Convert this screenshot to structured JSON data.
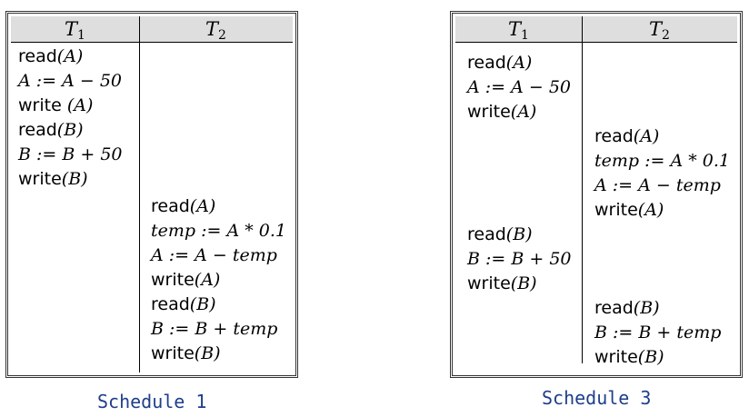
{
  "schedule1": {
    "caption": "Schedule 1",
    "col1": "T",
    "col1_sub": "1",
    "col2": "T",
    "col2_sub": "2",
    "t1": [
      {
        "fn": "read",
        "arg": "(A)"
      },
      {
        "expr": "A := A − 50"
      },
      {
        "fn": "write",
        "arg": " (A)"
      },
      {
        "fn": "read",
        "arg": "(B)"
      },
      {
        "expr": "B := B + 50"
      },
      {
        "fn": "write",
        "arg": "(B)"
      }
    ],
    "t2": [
      {
        "fn": "read",
        "arg": "(A)"
      },
      {
        "expr": "temp := A * 0.1"
      },
      {
        "expr": "A := A − temp"
      },
      {
        "fn": "write",
        "arg": "(A)"
      },
      {
        "fn": "read",
        "arg": "(B)"
      },
      {
        "expr": "B := B + temp"
      },
      {
        "fn": "write",
        "arg": "(B)"
      }
    ]
  },
  "schedule3": {
    "caption": "Schedule 3",
    "col1": "T",
    "col1_sub": "1",
    "col2": "T",
    "col2_sub": "2",
    "t1a": [
      {
        "fn": "read",
        "arg": "(A)"
      },
      {
        "expr": "A := A − 50"
      },
      {
        "fn": "write",
        "arg": "(A)"
      }
    ],
    "t2a": [
      {
        "fn": "read",
        "arg": "(A)"
      },
      {
        "expr": "temp := A * 0.1"
      },
      {
        "expr": "A := A − temp"
      },
      {
        "fn": "write",
        "arg": "(A)"
      }
    ],
    "t1b": [
      {
        "fn": "read",
        "arg": "(B)"
      },
      {
        "expr": "B := B + 50"
      },
      {
        "fn": "write",
        "arg": "(B)"
      }
    ],
    "t2b": [
      {
        "fn": "read",
        "arg": "(B)"
      },
      {
        "expr": "B := B + temp"
      },
      {
        "fn": "write",
        "arg": "(B)"
      }
    ]
  }
}
